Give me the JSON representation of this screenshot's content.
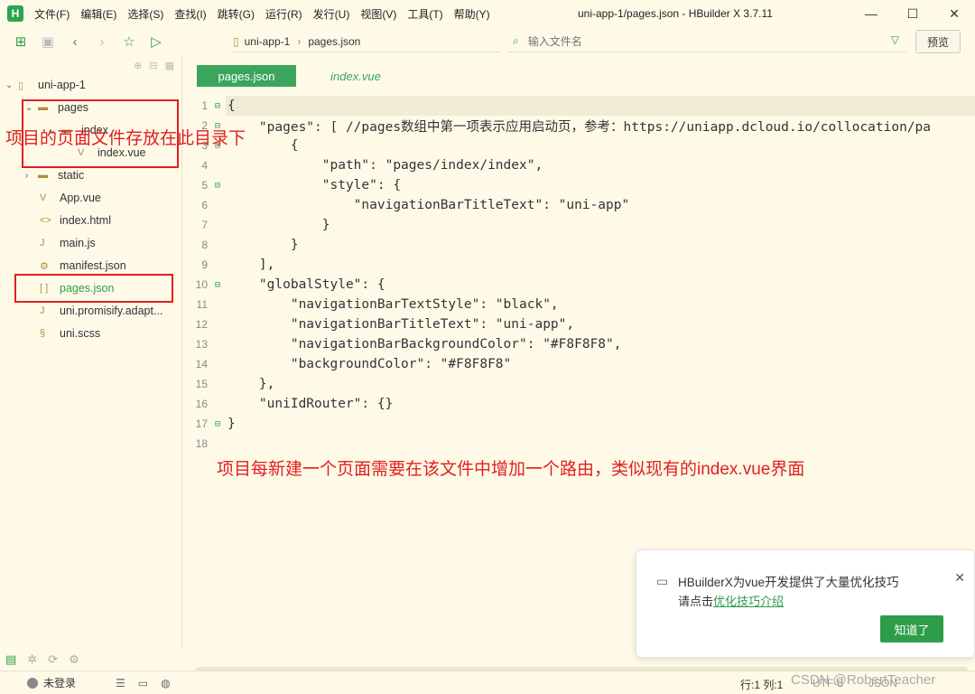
{
  "app": {
    "logo": "H",
    "window_title": "uni-app-1/pages.json - HBuilder X 3.7.11",
    "menu": [
      "文件(F)",
      "编辑(E)",
      "选择(S)",
      "查找(I)",
      "跳转(G)",
      "运行(R)",
      "发行(U)",
      "视图(V)",
      "工具(T)",
      "帮助(Y)"
    ]
  },
  "toolbar": {
    "breadcrumb": [
      "uni-app-1",
      "pages.json"
    ],
    "file_search_placeholder": "输入文件名",
    "preview_label": "预览"
  },
  "sidebar": {
    "project": "uni-app-1",
    "items": [
      {
        "label": "pages",
        "type": "folder",
        "expanded": true
      },
      {
        "label": "index",
        "type": "folder",
        "expanded": true
      },
      {
        "label": "index.vue",
        "type": "vue"
      },
      {
        "label": "static",
        "type": "folder",
        "expanded": false
      },
      {
        "label": "App.vue",
        "type": "vue"
      },
      {
        "label": "index.html",
        "type": "html"
      },
      {
        "label": "main.js",
        "type": "js"
      },
      {
        "label": "manifest.json",
        "type": "json"
      },
      {
        "label": "pages.json",
        "type": "json",
        "selected": true
      },
      {
        "label": "uni.promisify.adapt...",
        "type": "js"
      },
      {
        "label": "uni.scss",
        "type": "scss"
      }
    ]
  },
  "annotations": {
    "pages_dir": "项目的页面文件存放在此目录下",
    "pages_json": "项目每新建一个页面需要在该文件中增加一个路由，类似现有的index.vue界面"
  },
  "tabs": [
    {
      "label": "pages.json",
      "active": true
    },
    {
      "label": "index.vue",
      "active": false
    }
  ],
  "code_lines": [
    "{",
    "    \"pages\": [ //pages数组中第一项表示应用启动页，参考：https://uniapp.dcloud.io/collocation/pa",
    "        {",
    "            \"path\": \"pages/index/index\",",
    "            \"style\": {",
    "                \"navigationBarTitleText\": \"uni-app\"",
    "            }",
    "        }",
    "    ],",
    "    \"globalStyle\": {",
    "        \"navigationBarTextStyle\": \"black\",",
    "        \"navigationBarTitleText\": \"uni-app\",",
    "        \"navigationBarBackgroundColor\": \"#F8F8F8\",",
    "        \"backgroundColor\": \"#F8F8F8\"",
    "    },",
    "    \"uniIdRouter\": {}",
    "}",
    ""
  ],
  "toast": {
    "message": "HBuilderX为vue开发提供了大量优化技巧",
    "link_prefix": "请点击",
    "link_text": "优化技巧介绍",
    "button": "知道了"
  },
  "statusbar": {
    "login": "未登录",
    "cursor": "行:1  列:1",
    "encoding": "UTF-8",
    "language": "JSON"
  },
  "watermark": "CSDN @RobertTeacher",
  "colors": {
    "accent": "#2e9d4a",
    "annotation": "#e02020",
    "background": "#fffae8"
  }
}
